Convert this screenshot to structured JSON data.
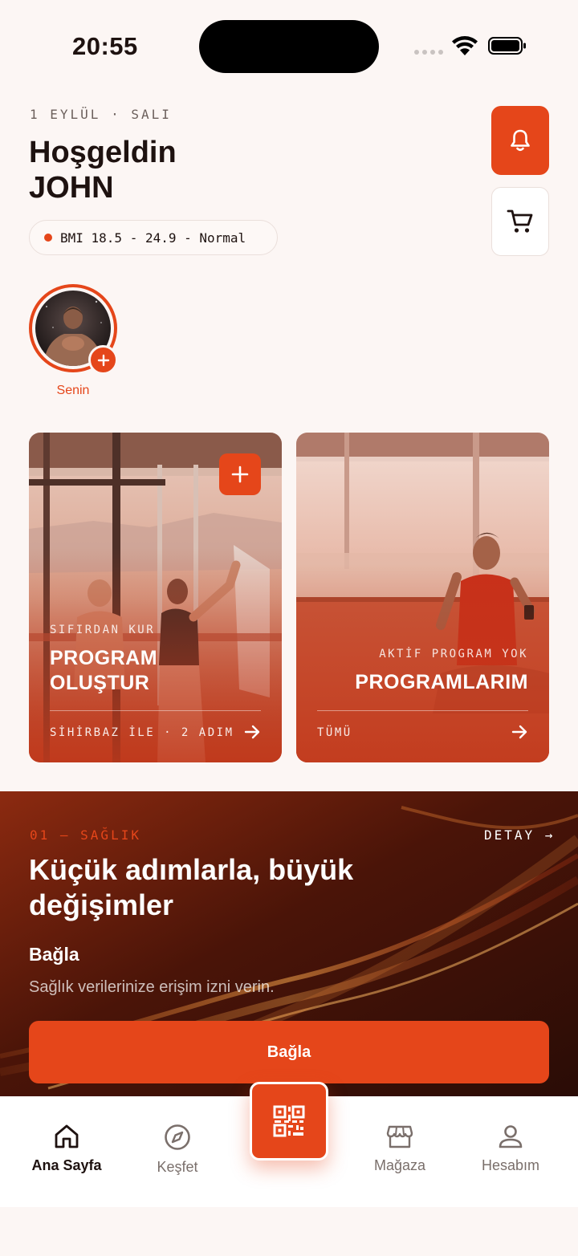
{
  "status_bar": {
    "time": "20:55"
  },
  "header": {
    "date": "1 EYLÜL · SALI",
    "greeting": "Hoşgeldin",
    "user_name": "JOHN",
    "bmi_text": "BMI 18.5 - 24.9 - Normal"
  },
  "story": {
    "label": "Senin"
  },
  "cards": {
    "create": {
      "kicker": "SIFIRDAN KUR",
      "title_line1": "PROGRAM",
      "title_line2": "OLUŞTUR",
      "footer": "SİHİRBAZ İLE · 2 ADIM"
    },
    "programs": {
      "kicker": "AKTİF PROGRAM YOK",
      "title": "PROGRAMLARIM",
      "footer": "TÜMÜ"
    }
  },
  "health": {
    "kicker": "01 — SAĞLIK",
    "detail_link": "DETAY →",
    "title": "Küçük adımlarla, büyük değişimler",
    "subtitle": "Bağla",
    "description": "Sağlık verilerinize erişim izni verin.",
    "button_label": "Bağla"
  },
  "tabbar": {
    "items": [
      {
        "label": "Ana Sayfa",
        "icon": "home-icon",
        "active": true
      },
      {
        "label": "Keşfet",
        "icon": "compass-icon",
        "active": false
      },
      {
        "label": "",
        "icon": "qr-code-icon",
        "active": false
      },
      {
        "label": "Mağaza",
        "icon": "store-icon",
        "active": false
      },
      {
        "label": "Hesabım",
        "icon": "user-icon",
        "active": false
      }
    ]
  },
  "colors": {
    "accent": "#e5461a",
    "background": "#fcf6f4",
    "text": "#1e1210"
  }
}
